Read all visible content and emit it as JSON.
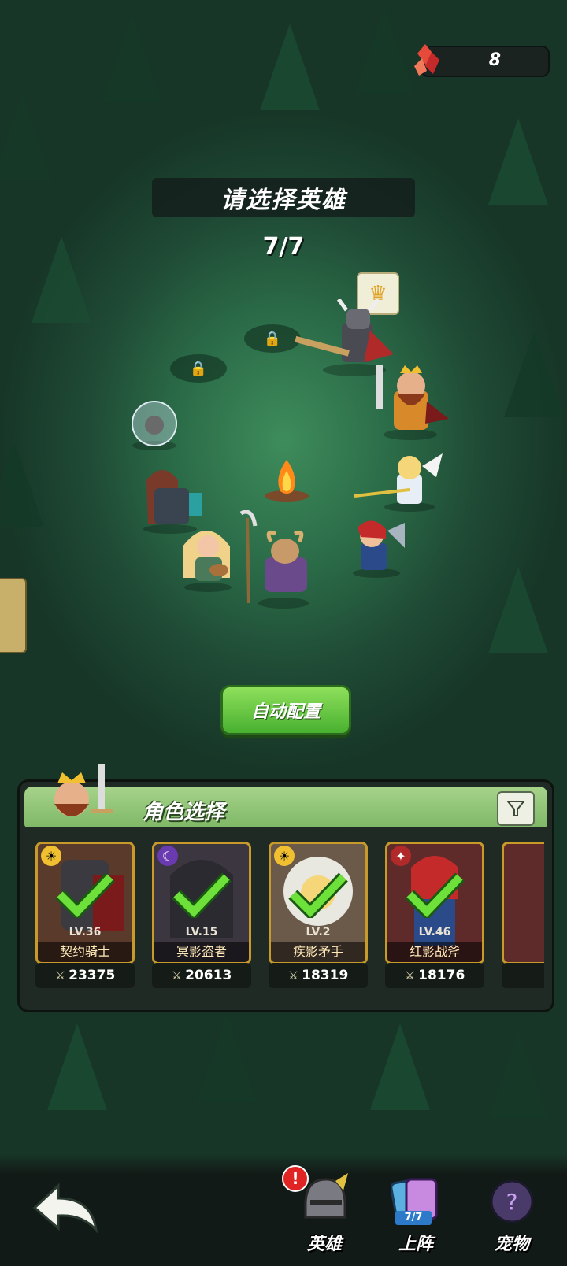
{
  "resources": {
    "gem_count": "8"
  },
  "header": {
    "title": "请选择英雄",
    "team_count": "7/7"
  },
  "auto_button": {
    "label": "自动配置"
  },
  "panel": {
    "title": "角色选择",
    "filter_icon": "filter-icon"
  },
  "heroes": [
    {
      "level": "LV.36",
      "name": "契约骑士",
      "power": "23375",
      "element": "sun",
      "selected": true
    },
    {
      "level": "LV.15",
      "name": "冥影盗者",
      "power": "20613",
      "element": "moon",
      "selected": true
    },
    {
      "level": "LV.2",
      "name": "疾影矛手",
      "power": "18319",
      "element": "sun",
      "selected": true
    },
    {
      "level": "LV.46",
      "name": "红影战斧",
      "power": "18176",
      "element": "blood",
      "selected": true
    }
  ],
  "nav": {
    "heroes_label": "英雄",
    "deploy_label": "上阵",
    "deploy_count": "7/7",
    "pets_label": "宠物",
    "alert": "!"
  },
  "colors": {
    "accent_green": "#48b030",
    "panel_header": "#a6d38a",
    "card_border": "#c89a2a",
    "alert": "#e02424"
  }
}
